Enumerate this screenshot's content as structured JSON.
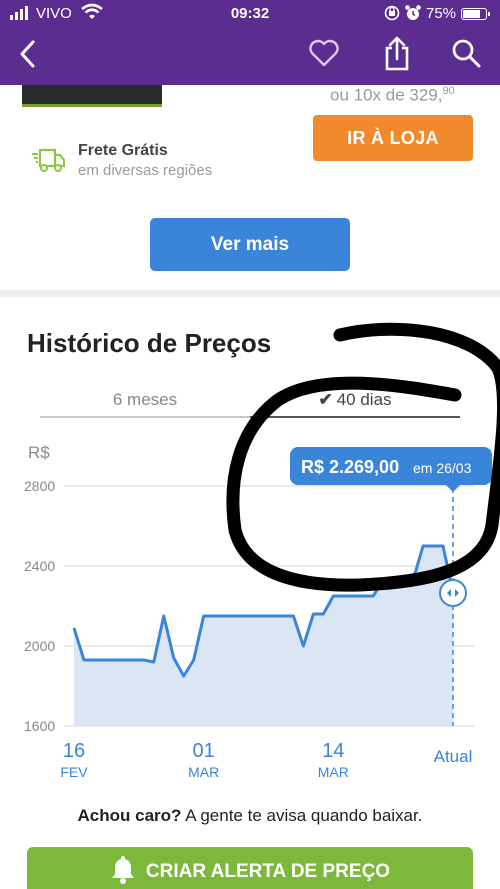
{
  "status_bar": {
    "carrier": "VIVO",
    "time": "09:32",
    "battery": "75%"
  },
  "header": {
    "icons": [
      "back-icon",
      "heart-icon",
      "share-icon",
      "search-icon"
    ],
    "color": "#5b2d91"
  },
  "offer": {
    "installments": "ou 10x de 329,",
    "installments_cents": "90",
    "store_button": "IR À LOJA",
    "shipping_title": "Frete Grátis",
    "shipping_subtitle": "em diversas regiões",
    "more_button": "Ver mais"
  },
  "history": {
    "title": "Histórico de Preços",
    "tabs": [
      {
        "label": "6 meses",
        "active": false
      },
      {
        "label": "40 dias",
        "active": true
      }
    ],
    "unit": "R$",
    "tooltip_price": "R$ 2.269,00",
    "tooltip_date": "em 26/03"
  },
  "chart_data": {
    "type": "area",
    "title": "Histórico de Preços",
    "ylabel": "R$",
    "ylim": [
      1600,
      2800
    ],
    "yticks": [
      1600,
      2000,
      2400,
      2800
    ],
    "xticks": [
      {
        "day": "16",
        "month": "FEV",
        "date": "2019-02-16"
      },
      {
        "day": "01",
        "month": "MAR",
        "date": "2019-03-01"
      },
      {
        "day": "14",
        "month": "MAR",
        "date": "2019-03-14"
      },
      {
        "day": "Atual",
        "month": "",
        "date": "2019-03-26"
      }
    ],
    "x": [
      "2019-02-16",
      "2019-02-17",
      "2019-02-18",
      "2019-02-19",
      "2019-02-20",
      "2019-02-21",
      "2019-02-22",
      "2019-02-23",
      "2019-02-24",
      "2019-02-25",
      "2019-02-26",
      "2019-02-27",
      "2019-02-28",
      "2019-03-01",
      "2019-03-02",
      "2019-03-03",
      "2019-03-04",
      "2019-03-05",
      "2019-03-06",
      "2019-03-07",
      "2019-03-08",
      "2019-03-09",
      "2019-03-10",
      "2019-03-11",
      "2019-03-12",
      "2019-03-13",
      "2019-03-14",
      "2019-03-15",
      "2019-03-16",
      "2019-03-17",
      "2019-03-18",
      "2019-03-19",
      "2019-03-20",
      "2019-03-21",
      "2019-03-22",
      "2019-03-23",
      "2019-03-24",
      "2019-03-25",
      "2019-03-26"
    ],
    "values": [
      2090,
      1930,
      1930,
      1930,
      1930,
      1930,
      1930,
      1930,
      1920,
      2150,
      1940,
      1850,
      1930,
      2150,
      2150,
      2150,
      2150,
      2150,
      2150,
      2150,
      2150,
      2150,
      2150,
      2000,
      2160,
      2160,
      2250,
      2250,
      2250,
      2250,
      2250,
      2330,
      2330,
      2330,
      2330,
      2500,
      2500,
      2500,
      2269
    ],
    "highlight": {
      "date": "2019-03-26",
      "value": 2269
    },
    "fill_color": "#dbe6f4",
    "line_color": "#3a85d9",
    "grid": true
  },
  "alert": {
    "lead": "Achou caro?",
    "text": " A gente te avisa quando baixar.",
    "button": "CRIAR ALERTA DE PREÇO"
  }
}
